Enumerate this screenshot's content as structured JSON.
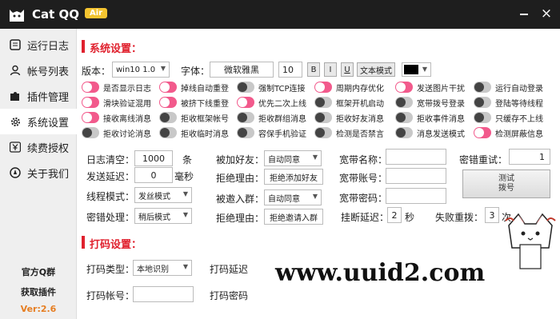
{
  "app": {
    "title": "Cat QQ",
    "badge": "Air"
  },
  "window": {
    "close_symbol": "×"
  },
  "sidebar": {
    "items": [
      {
        "label": "运行日志",
        "icon": "log-icon"
      },
      {
        "label": "帐号列表",
        "icon": "user-icon"
      },
      {
        "label": "插件管理",
        "icon": "puzzle-icon"
      },
      {
        "label": "系统设置",
        "icon": "gear-icon",
        "active": true
      },
      {
        "label": "续费授权",
        "icon": "yen-icon"
      },
      {
        "label": "关于我们",
        "icon": "compass-icon"
      }
    ],
    "official_group": "官方Q群",
    "get_plugins": "获取插件",
    "version": "Ver:2.6"
  },
  "system": {
    "title": "系统设置：",
    "version_label": "版本：",
    "version_value": "win10 1.0",
    "font_label": "字体：",
    "font_value": "微软雅黑",
    "font_size": "10",
    "bold": "B",
    "italic": "I",
    "underline": "U",
    "text_mode": "文本模式",
    "color_value": "#000000",
    "toggles": [
      {
        "label": "是否显示日志",
        "on": true
      },
      {
        "label": "掉线自动重登",
        "on": true
      },
      {
        "label": "强制TCP连接",
        "on": false
      },
      {
        "label": "周期内存优化",
        "on": true
      },
      {
        "label": "发送图片干扰",
        "on": true
      },
      {
        "label": "运行自动登录",
        "on": false
      },
      {
        "label": "滑块验证混用",
        "on": true
      },
      {
        "label": "被挤下线重登",
        "on": true
      },
      {
        "label": "优先二次上线",
        "on": true
      },
      {
        "label": "框架开机启动",
        "on": false
      },
      {
        "label": "宽带拨号登录",
        "on": false
      },
      {
        "label": "登陆等待线程",
        "on": false
      },
      {
        "label": "接收离线消息",
        "on": true
      },
      {
        "label": "拒收框架帐号",
        "on": false
      },
      {
        "label": "拒收群组消息",
        "on": false
      },
      {
        "label": "拒收好友消息",
        "on": false
      },
      {
        "label": "拒收事件消息",
        "on": false
      },
      {
        "label": "只缓存不上线",
        "on": false
      },
      {
        "label": "拒收讨论消息",
        "on": false
      },
      {
        "label": "拒收临时消息",
        "on": false
      },
      {
        "label": "容保手机验证",
        "on": false
      },
      {
        "label": "检测是否禁言",
        "on": false
      },
      {
        "label": "消息发送模式",
        "on": false
      },
      {
        "label": "检测屏蔽信息",
        "on": true
      }
    ],
    "log_clear_label": "日志清空：",
    "log_clear_value": "1000",
    "log_clear_unit": "条",
    "send_delay_label": "发送延迟：",
    "send_delay_value": "0",
    "send_delay_unit": "毫秒",
    "thread_mode_label": "线程模式：",
    "thread_mode_value": "发丝模式",
    "pwd_handle_label": "密错处理：",
    "pwd_handle_value": "稍后模式",
    "add_friend_label": "被加好友：",
    "add_friend_value": "自动同意",
    "reject_reason_label": "拒绝理由：",
    "reject_reason_value": "拒绝添加好友",
    "invite_group_label": "被邀入群：",
    "invite_group_value": "自动同意",
    "reject_reason2_label": "拒绝理由：",
    "reject_reason2_value": "拒绝邀请入群",
    "bb_name_label": "宽带名称：",
    "bb_name_value": "",
    "bb_account_label": "宽带账号：",
    "bb_account_value": "",
    "bb_pwd_label": "宽带密码：",
    "bb_pwd_value": "",
    "pwd_retry_label": "密错重试：",
    "pwd_retry_value": "1",
    "test_dial": "测试\n拨号",
    "hangup_delay_label": "挂断延迟：",
    "hangup_delay_value": "2",
    "hangup_delay_unit": "秒",
    "fail_redial_label": "失败重拨：",
    "fail_redial_value": "3",
    "fail_redial_unit": "次"
  },
  "captcha": {
    "title": "打码设置：",
    "type_label": "打码类型：",
    "type_value": "本地识别",
    "delay_label": "打码延迟",
    "account_label": "打码帐号：",
    "account_value": "",
    "password_label": "打码密码"
  },
  "watermark": "www.uuid2.com"
}
